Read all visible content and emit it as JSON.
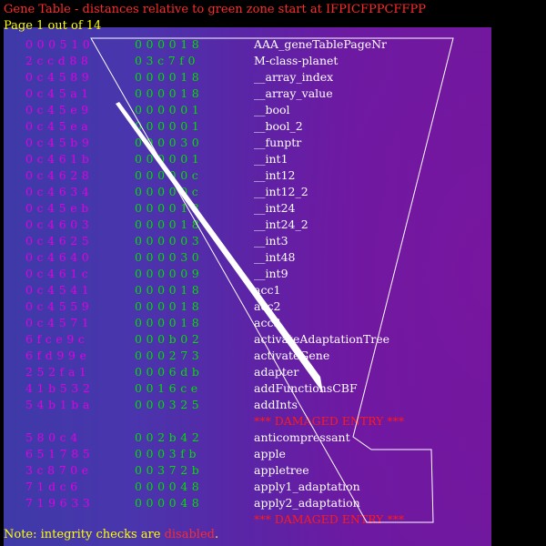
{
  "header": {
    "title": "Gene Table - distances relative to green zone start at IFPICFPPCFFPP",
    "page_info": "Page 1 out of 14"
  },
  "rows": [
    {
      "addr": "000510",
      "dist": "000018",
      "name": "AAA_geneTablePageNr"
    },
    {
      "addr": "2ccd88",
      "dist": "03c7f0",
      "name": "M-class-planet"
    },
    {
      "addr": "0c4589",
      "dist": "000018",
      "name": "__array_index"
    },
    {
      "addr": "0c45a1",
      "dist": "000018",
      "name": "__array_value"
    },
    {
      "addr": "0c45e9",
      "dist": "000001",
      "name": "__bool"
    },
    {
      "addr": "0c45ea",
      "dist": "000001",
      "name": "__bool_2"
    },
    {
      "addr": "0c45b9",
      "dist": "000030",
      "name": "__funptr"
    },
    {
      "addr": "0c461b",
      "dist": "000001",
      "name": "__int1"
    },
    {
      "addr": "0c4628",
      "dist": "00000c",
      "name": "__int12"
    },
    {
      "addr": "0c4634",
      "dist": "00000c",
      "name": "__int12_2"
    },
    {
      "addr": "0c45eb",
      "dist": "000018",
      "name": "__int24"
    },
    {
      "addr": "0c4603",
      "dist": "000018",
      "name": "__int24_2"
    },
    {
      "addr": "0c4625",
      "dist": "000003",
      "name": "__int3"
    },
    {
      "addr": "0c4640",
      "dist": "000030",
      "name": "__int48"
    },
    {
      "addr": "0c461c",
      "dist": "000009",
      "name": "__int9"
    },
    {
      "addr": "0c4541",
      "dist": "000018",
      "name": "acc1"
    },
    {
      "addr": "0c4559",
      "dist": "000018",
      "name": "acc2"
    },
    {
      "addr": "0c4571",
      "dist": "000018",
      "name": "acc3"
    },
    {
      "addr": "6fce9c",
      "dist": "000b02",
      "name": "activateAdaptationTree"
    },
    {
      "addr": "6fd99e",
      "dist": "000273",
      "name": "activateGene"
    },
    {
      "addr": "252fa1",
      "dist": "0006db",
      "name": "adapter"
    },
    {
      "addr": "41b532",
      "dist": "0016ce",
      "name": "addFunctionsCBF"
    },
    {
      "addr": "54b1ba",
      "dist": "000325",
      "name": "addInts"
    },
    {
      "damaged": "*** DAMAGED ENTRY ***"
    },
    {
      "addr": "580c4",
      "dist": "002b42",
      "name": "anticompressant"
    },
    {
      "addr": "651785",
      "dist": "0003fb",
      "name": "apple"
    },
    {
      "addr": "3c870e",
      "dist": "00372b",
      "name": "appletree"
    },
    {
      "addr": "71dc6",
      "dist": "000048",
      "name": "apply1_adaptation"
    },
    {
      "addr": "719633",
      "dist": "000048",
      "name": "apply2_adaptation"
    },
    {
      "damaged": "*** DAMAGED ENTRY ***"
    }
  ],
  "footer": {
    "prefix": "Note: integrity checks are ",
    "status": "disabled",
    "suffix": "."
  },
  "colors": {
    "title": "#ff2a2a",
    "page_info": "#ffff00",
    "address": "#e000e0",
    "distance": "#00e000",
    "name": "#ffffff",
    "damaged": "#ff1a1a",
    "footer": "#ffff00",
    "disabled": "#ff2a2a"
  }
}
